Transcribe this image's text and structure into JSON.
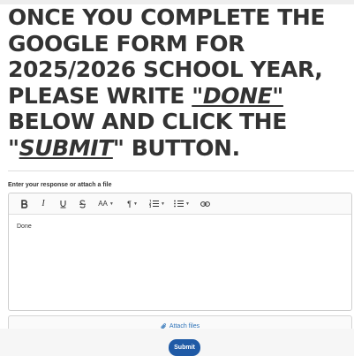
{
  "instructions": {
    "part1": "ONCE YOU COMPLETE THE GOOGLE FORM FOR 2025/2026 SCHOOL YEAR, PLEASE WRITE ",
    "part2": "\"DONE\"",
    "part3": " BELOW AND CLICK THE \"",
    "part4": "SUBMIT",
    "part5": "\" BUTTON."
  },
  "response": {
    "label": "Enter your response or attach a file",
    "value": "Done",
    "attach_label": "Attach files"
  },
  "toolbar": {
    "italic": "I",
    "font_size": "AA",
    "paragraph": "¶"
  },
  "submit_label": "Submit",
  "colors": {
    "accent": "#1f5aa6",
    "link": "#2c72b8"
  }
}
